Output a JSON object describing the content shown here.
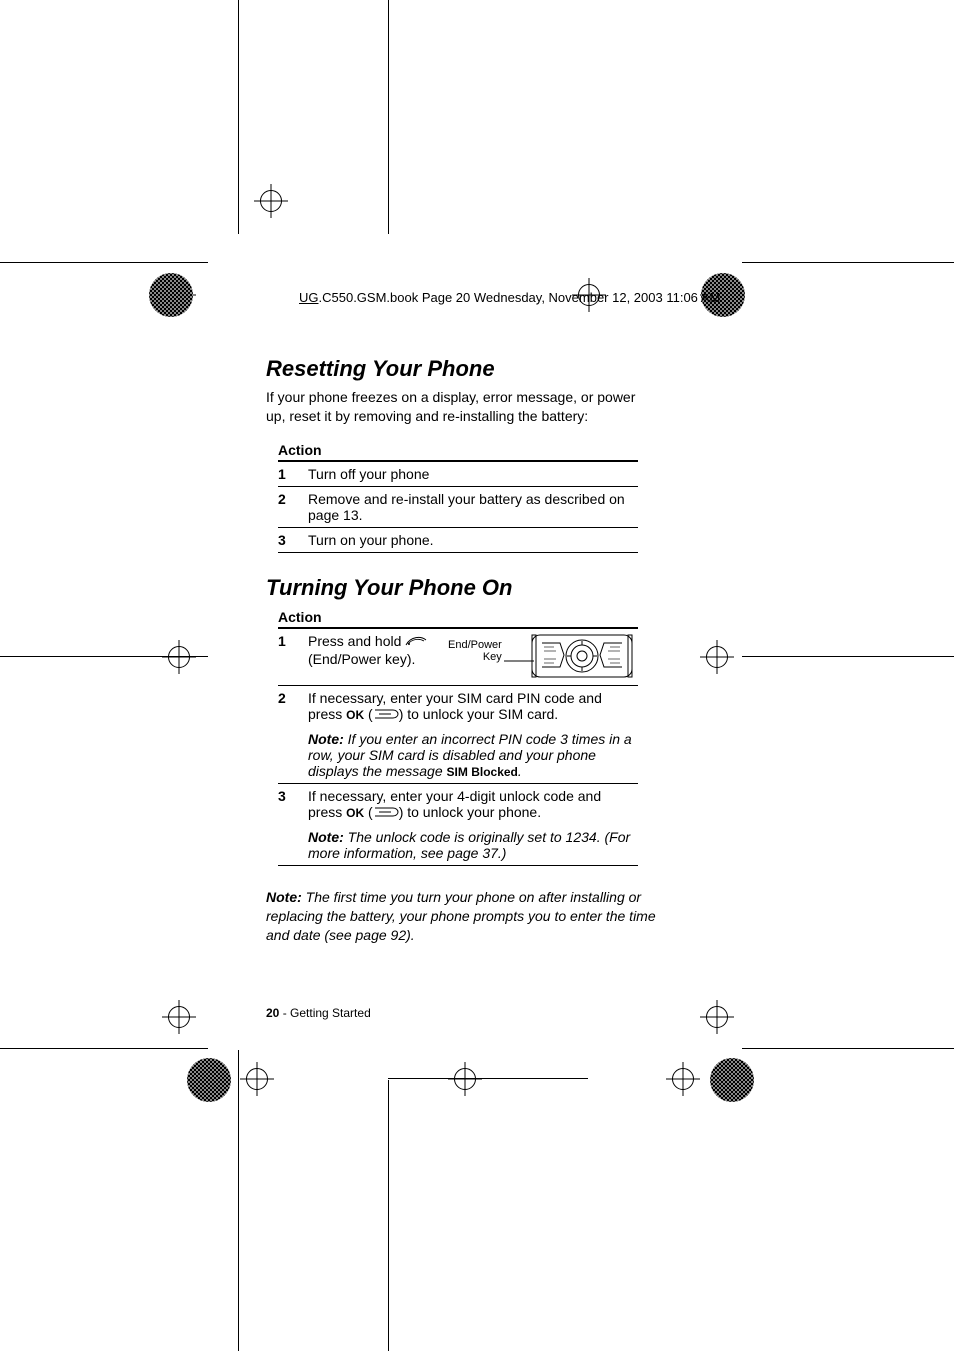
{
  "header": {
    "filename_prefix": "UG",
    "filename_rest": ".C550.GSM.book  Page 20  Wednesday, November 12, 2003  11:06 AM"
  },
  "section1": {
    "title": "Resetting Your Phone",
    "intro": "If your phone freezes on a display, error message, or power up, reset it by removing and re-installing the battery:",
    "action_header": "Action",
    "steps": [
      {
        "n": "1",
        "text": "Turn off your phone"
      },
      {
        "n": "2",
        "text": "Remove and re-install your battery as described on page 13."
      },
      {
        "n": "3",
        "text": "Turn on your phone."
      }
    ]
  },
  "section2": {
    "title": "Turning Your Phone On",
    "action_header": "Action",
    "step1": {
      "n": "1",
      "text_a": "Press and hold ",
      "text_b": " (End/Power key).",
      "diagram_label_a": "End/Power",
      "diagram_label_b": "Key"
    },
    "step2": {
      "n": "2",
      "line1_a": "If necessary, enter your SIM card PIN code and press ",
      "ok_label": "OK",
      "line1_b": " (",
      "line1_c": ") to unlock your SIM card.",
      "note_label": "Note:",
      "note_body_a": " If you enter an incorrect PIN code 3 times in a row, your SIM card is disabled and your phone displays the message ",
      "sim_blocked": "SIM Blocked",
      "note_body_b": "."
    },
    "step3": {
      "n": "3",
      "line1_a": "If necessary, enter your 4-digit unlock code and press ",
      "ok_label": "OK",
      "line1_b": " (",
      "line1_c": ") to unlock your phone.",
      "note_label": "Note:",
      "note_body": " The unlock code is originally set to 1234. (For more information, see page 37.)"
    },
    "final_note_label": "Note:",
    "final_note_body": " The first time you turn your phone on after installing or replacing the battery, your phone prompts you to enter the time and date (see page 92)."
  },
  "footer": {
    "page_number": "20",
    "section_name": " - Getting Started"
  }
}
